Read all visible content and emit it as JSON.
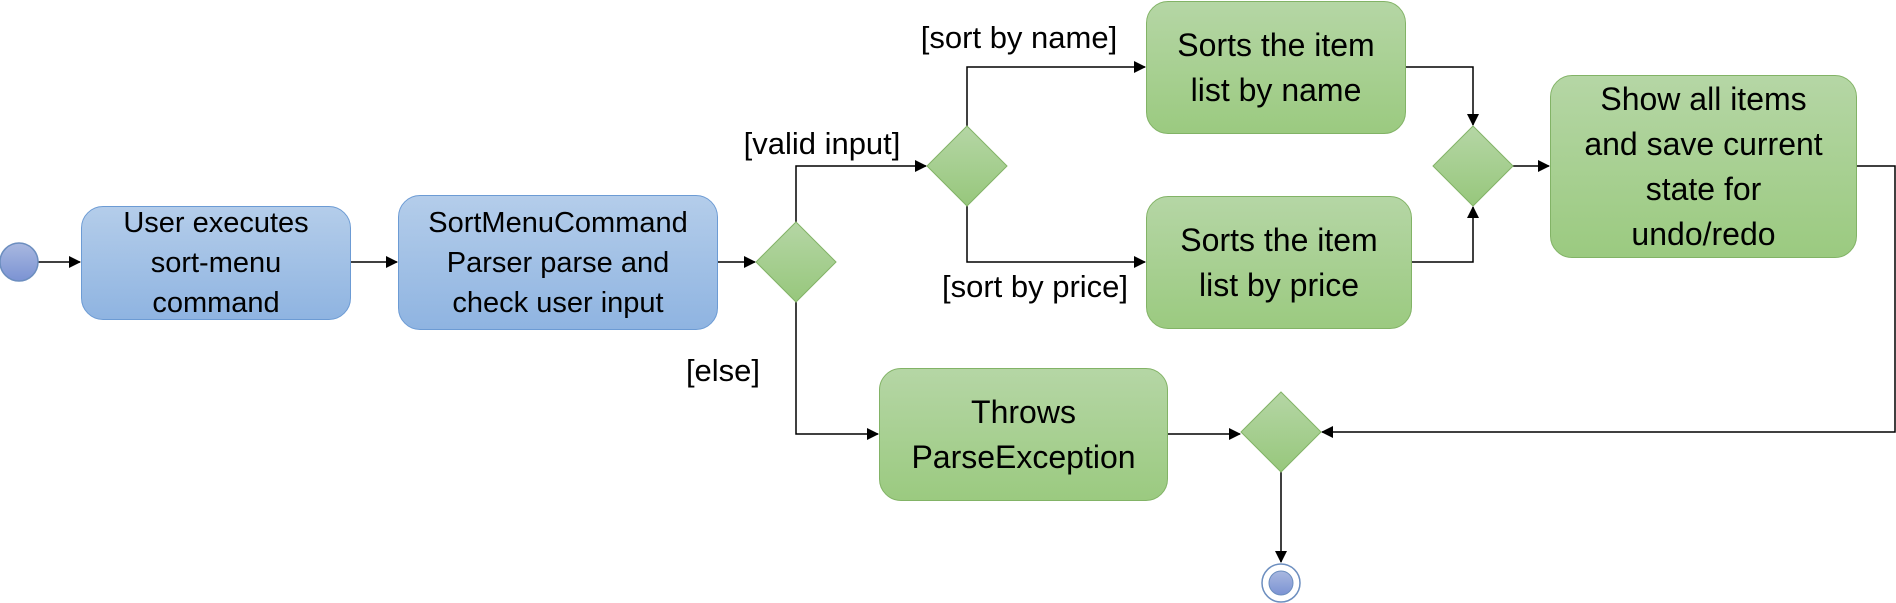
{
  "diagram": {
    "type": "activity",
    "colors": {
      "action_blue": "#9dbde4",
      "action_green": "#a7cf8e",
      "line": "#000000"
    },
    "nodes": {
      "execute": "User executes\nsort-menu\ncommand",
      "parse": "SortMenuCommand\nParser parse and\ncheck user input",
      "sort_name": "Sorts the item\nlist by name",
      "sort_price": "Sorts the item\nlist by price",
      "show": "Show all items\nand save current\nstate for\nundo/redo",
      "throws": "Throws\nParseException"
    },
    "guards": {
      "valid": "[valid input]",
      "else": "[else]",
      "by_name": "[sort by name]",
      "by_price": "[sort by price]"
    }
  }
}
